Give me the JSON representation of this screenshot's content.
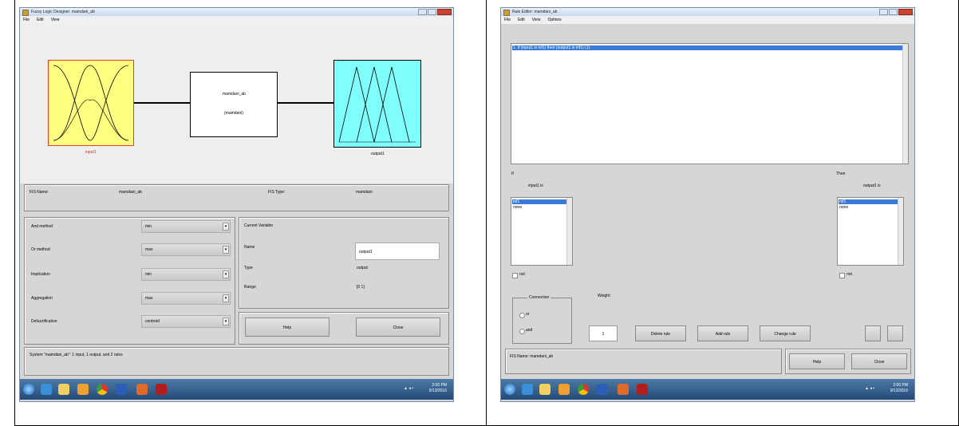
{
  "left_window": {
    "title": "Fuzzy Logic Designer: mamdani_ab",
    "menu": [
      "File",
      "Edit",
      "View"
    ],
    "input_block_label": "input1",
    "center_block": {
      "name": "mamdani_ab",
      "type": "(mamdani)"
    },
    "output_block_label": "output1",
    "fis_name_label": "FIS Name:",
    "fis_name_value": "mamdani_ab",
    "fis_type_label": "FIS Type:",
    "fis_type_value": "mamdani",
    "methods": [
      {
        "label": "And method",
        "value": "min"
      },
      {
        "label": "Or method",
        "value": "max"
      },
      {
        "label": "Implication",
        "value": "min"
      },
      {
        "label": "Aggregation",
        "value": "max"
      },
      {
        "label": "Defuzzification",
        "value": "centroid"
      }
    ],
    "current_variable": {
      "title": "Current Variable",
      "name_label": "Name",
      "name_value": "output1",
      "type_label": "Type",
      "type_value": "output",
      "range_label": "Range",
      "range_value": "[0 1]"
    },
    "help_label": "Help",
    "close_label": "Close",
    "status": "System \"mamdani_ab\": 1 input, 1 output, and 2 rules"
  },
  "right_window": {
    "title": "Rule Editor: mamdani_ab",
    "menu": [
      "File",
      "Edit",
      "View",
      "Options"
    ],
    "rule_text": "1. If (input1 is mf1) then (output1 is mf1) (1)",
    "if_label": "If",
    "then_label": "Then",
    "input_var": "input1 is",
    "output_var": "output1 is",
    "input_items": [
      "mf1",
      "none"
    ],
    "output_items": [
      "mf1",
      "none"
    ],
    "not_label": "not",
    "connection_title": "Connection",
    "or_label": "or",
    "and_label": "and",
    "weight_label": "Weight:",
    "weight_value": "1",
    "delete_label": "Delete rule",
    "add_label": "Add rule",
    "change_label": "Change rule",
    "status": "FIS Name: mamdani_ab",
    "help_label": "Help",
    "close_label": "Close"
  },
  "taskbar": {
    "time": "2:00 PM",
    "date": "9/13/2016"
  },
  "colors": {
    "input_block": "#ffff80",
    "output_block": "#80ffff",
    "selection": "#3a7bd5",
    "taskbar": "#2e5a8a"
  }
}
